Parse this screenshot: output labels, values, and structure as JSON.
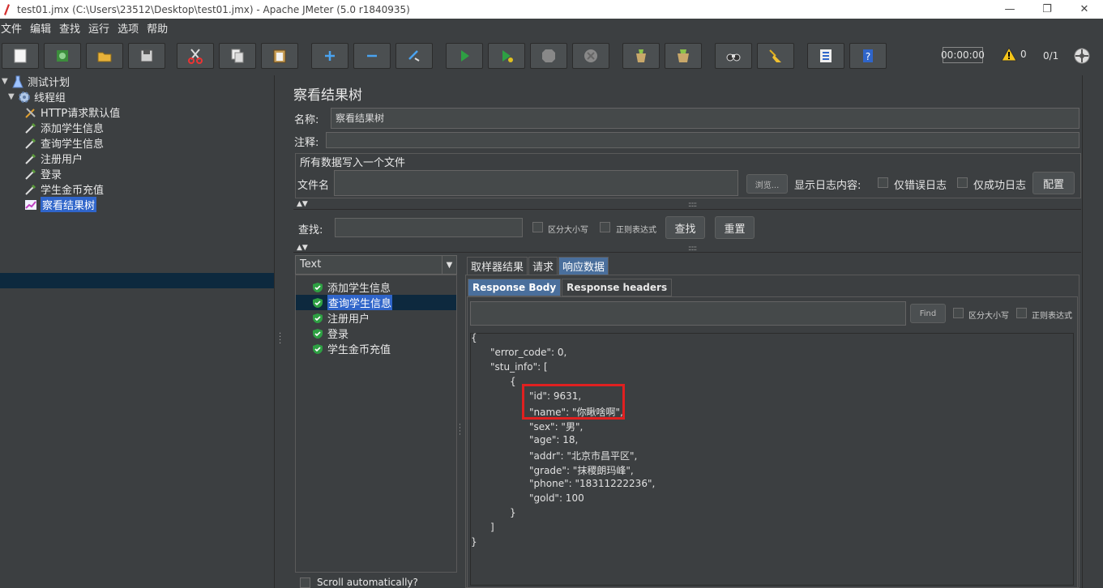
{
  "window": {
    "title": "test01.jmx (C:\\Users\\23512\\Desktop\\test01.jmx) - Apache JMeter (5.0 r1840935)",
    "minimize": "—",
    "maximize": "❐",
    "close": "✕"
  },
  "menu": [
    "文件",
    "编辑",
    "查找",
    "运行",
    "选项",
    "帮助"
  ],
  "toolbar": {
    "icons": [
      "new-icon",
      "templates-icon",
      "open-icon",
      "save-icon",
      "cut-icon",
      "copy-icon",
      "paste-icon",
      "expand-icon",
      "collapse-icon",
      "toggle-icon",
      "start-icon",
      "start-no-pause-icon",
      "stop-icon",
      "shutdown-icon",
      "clear-icon",
      "clear-all-icon",
      "search-icon",
      "reset-search-icon",
      "function-helper-icon",
      "help-icon"
    ],
    "timer": "00:00:00",
    "warnings": "0",
    "threads": "0/1"
  },
  "tree": {
    "items": [
      {
        "label": "测试计划",
        "icon": "test-plan-icon"
      },
      {
        "label": "线程组",
        "icon": "thread-group-icon"
      },
      {
        "label": "HTTP请求默认值",
        "icon": "config-icon"
      },
      {
        "label": "添加学生信息",
        "icon": "sampler-icon"
      },
      {
        "label": "查询学生信息",
        "icon": "sampler-icon"
      },
      {
        "label": "注册用户",
        "icon": "sampler-icon"
      },
      {
        "label": "登录",
        "icon": "sampler-icon"
      },
      {
        "label": "学生金币充值",
        "icon": "sampler-icon"
      },
      {
        "label": "察看结果树",
        "icon": "listener-icon",
        "selected": true
      }
    ]
  },
  "panel": {
    "title": "察看结果树",
    "name_label": "名称:",
    "name_value": "察看结果树",
    "comment_label": "注释:",
    "comment_value": "",
    "group_title": "所有数据写入一个文件",
    "filename_label": "文件名",
    "browse_label": "浏览...",
    "log_label": "显示日志内容:",
    "errors_only": "仅错误日志",
    "success_only": "仅成功日志",
    "configure": "配置",
    "search_label": "查找:",
    "case_sensitive": "区分大小写",
    "regex": "正则表达式",
    "search_button": "查找",
    "reset_button": "重置"
  },
  "results": {
    "renderer": "Text",
    "items": [
      "添加学生信息",
      "查询学生信息",
      "注册用户",
      "登录",
      "学生金币充值"
    ],
    "selected_index": 1,
    "scroll_auto": "Scroll automatically?"
  },
  "tabs": [
    "取样器结果",
    "请求",
    "响应数据"
  ],
  "subtabs": [
    "Response Body",
    "Response headers"
  ],
  "find": {
    "button": "Find",
    "case_sensitive": "区分大小写",
    "regex": "正则表达式"
  },
  "response_lines": [
    "{",
    "\"error_code\": 0,",
    "\"stu_info\": [",
    "{",
    "\"id\": 9631,",
    "\"name\": \"你瞅啥啊\",",
    "\"sex\": \"男\",",
    "\"age\": 18,",
    "\"addr\": \"北京市昌平区\",",
    "\"grade\": \"抹稷朗玛峰\",",
    "\"phone\": \"18311222236\",",
    "\"gold\": 100",
    "}",
    "]",
    "}"
  ]
}
